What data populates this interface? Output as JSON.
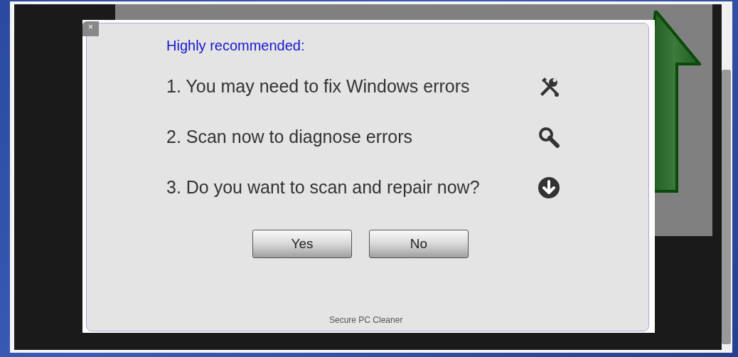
{
  "dialog": {
    "close": "×",
    "heading": "Highly recommended:",
    "items": [
      {
        "text": "1. You may need to fix Windows errors",
        "kind": "tools"
      },
      {
        "text": "2. Scan now to diagnose errors",
        "kind": "search"
      },
      {
        "text": "3. Do you want to scan and repair now?",
        "kind": "download"
      }
    ],
    "buttons": [
      "Yes",
      "No"
    ],
    "footer": "Secure PC Cleaner"
  }
}
